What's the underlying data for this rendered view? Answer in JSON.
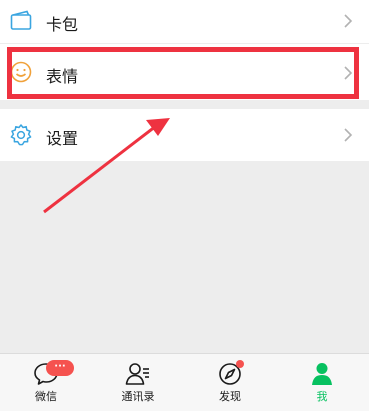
{
  "menu": {
    "wallet_label": "卡包",
    "stickers_label": "表情",
    "settings_label": "设置"
  },
  "tabbar": {
    "chats_label": "微信",
    "chats_badge": "···",
    "contacts_label": "通讯录",
    "discover_label": "发现",
    "me_label": "我"
  },
  "colors": {
    "accent_green": "#07c160",
    "annotation_red": "#ee3240",
    "badge_red": "#f5524f",
    "icon_blue": "#3aa5e0",
    "sticker_orange": "#f0a13a"
  },
  "icons": {
    "wallet": "card-wallet-icon",
    "stickers": "smiley-icon",
    "settings": "gear-icon",
    "chats": "chat-bubble-icon",
    "contacts": "contacts-icon",
    "discover": "compass-icon",
    "me": "person-icon"
  }
}
